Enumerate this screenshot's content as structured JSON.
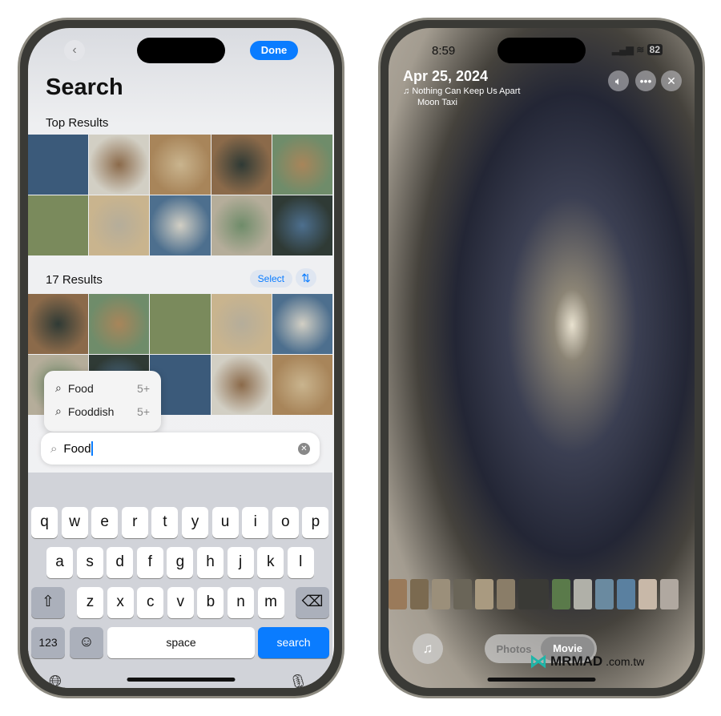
{
  "left": {
    "done": "Done",
    "title": "Search",
    "top_results": "Top Results",
    "results_count": "17 Results",
    "select": "Select",
    "suggestions": [
      {
        "label": "Food",
        "count": "5+"
      },
      {
        "label": "Fooddish",
        "count": "5+"
      }
    ],
    "search_value": "Food",
    "keyboard": {
      "row1": [
        "q",
        "w",
        "e",
        "r",
        "t",
        "y",
        "u",
        "i",
        "o",
        "p"
      ],
      "row2": [
        "a",
        "s",
        "d",
        "f",
        "g",
        "h",
        "j",
        "k",
        "l"
      ],
      "row3": [
        "z",
        "x",
        "c",
        "v",
        "b",
        "n",
        "m"
      ],
      "numbers": "123",
      "space": "space",
      "search": "search"
    },
    "accent": "#0a7cff"
  },
  "right": {
    "time": "8:59",
    "battery": "82",
    "date": "Apr 25, 2024",
    "song": "Nothing Can Keep Us Apart",
    "artist": "Moon Taxi",
    "seg": [
      "Photos",
      "Movie"
    ],
    "watermark": "MRMAD",
    "watermark_suffix": ".com.tw"
  }
}
